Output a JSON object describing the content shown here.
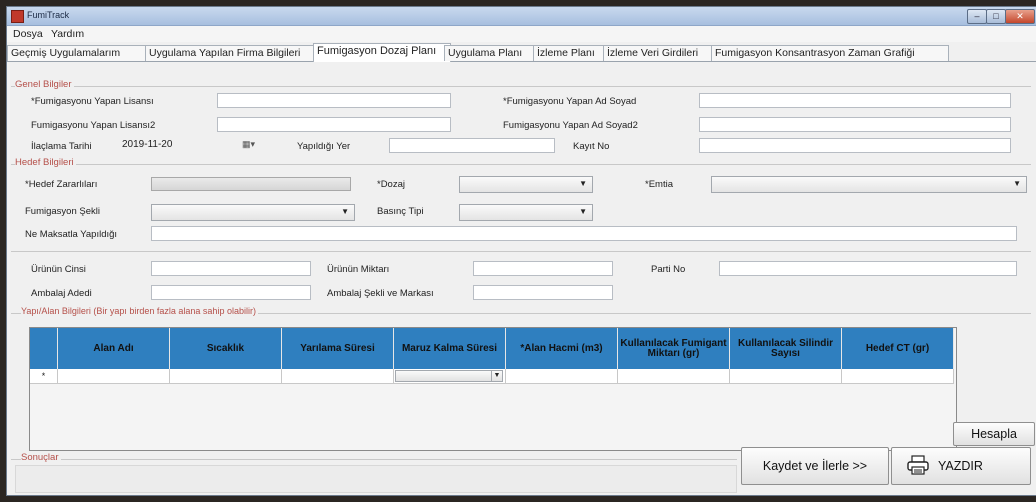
{
  "window": {
    "title": "FumiTrack"
  },
  "menu": {
    "items": [
      "Dosya",
      "Yardım"
    ]
  },
  "tabs": [
    "Geçmiş Uygulamalarım",
    "Uygulama Yapılan Firma Bilgileri",
    "Fumigasyon Dozaj Planı",
    "Uygulama Planı",
    "İzleme Planı",
    "İzleme Veri Girdileri",
    "Fumigasyon Konsantrasyon Zaman Grafiği"
  ],
  "active_tab": "Fumigasyon Dozaj Planı",
  "genel": {
    "legend": "Genel Bilgiler",
    "lisans_label": "*Fumigasyonu Yapan Lisansı",
    "lisans_value": "",
    "adsoyad_label": "*Fumigasyonu Yapan Ad Soyad",
    "adsoyad_value": "",
    "lisans2_label": "Fumigasyonu Yapan Lisansı2",
    "lisans2_value": "",
    "adsoyad2_label": "Fumigasyonu Yapan Ad Soyad2",
    "adsoyad2_value": "",
    "tarih_label": "İlaçlama Tarihi",
    "tarih_value": "2019-11-20",
    "yer_label": "Yapıldığı Yer",
    "yer_value": "",
    "kayit_label": "Kayıt No",
    "kayit_value": ""
  },
  "hedef": {
    "legend": "Hedef Bilgileri",
    "zararlilar_label": "*Hedef Zararlıları",
    "dozaj_label": "*Dozaj",
    "emtia_label": "*Emtia",
    "sekil_label": "Fumigasyon Şekli",
    "basinc_label": "Basınç Tipi",
    "maksat_label": "Ne Maksatla Yapıldığı",
    "maksat_value": ""
  },
  "urun": {
    "cinsi_label": "Ürünün Cinsi",
    "miktari_label": "Ürünün Miktarı",
    "parti_label": "Parti No",
    "ambalaj_adedi_label": "Ambalaj Adedi",
    "ambalaj_sekli_label": "Ambalaj Şekli ve Markası"
  },
  "yapi": {
    "legend": "Yapı/Alan Bilgileri (Bir yapı birden fazla alana sahip olabilir)",
    "columns": [
      "Alan Adı",
      "Sıcaklık",
      "Yarılama Süresi",
      "Maruz Kalma Süresi",
      "*Alan Hacmi (m3)",
      "Kullanılacak Fumigant Miktarı (gr)",
      "Kullanılacak Silindir Sayısı",
      "Hedef CT (gr)"
    ],
    "new_row_marker": "*"
  },
  "sonuclar": {
    "legend": "Sonuçlar"
  },
  "buttons": {
    "hesapla": "Hesapla",
    "kaydet": "Kaydet ve İlerle >>",
    "yazdir": "YAZDIR"
  }
}
